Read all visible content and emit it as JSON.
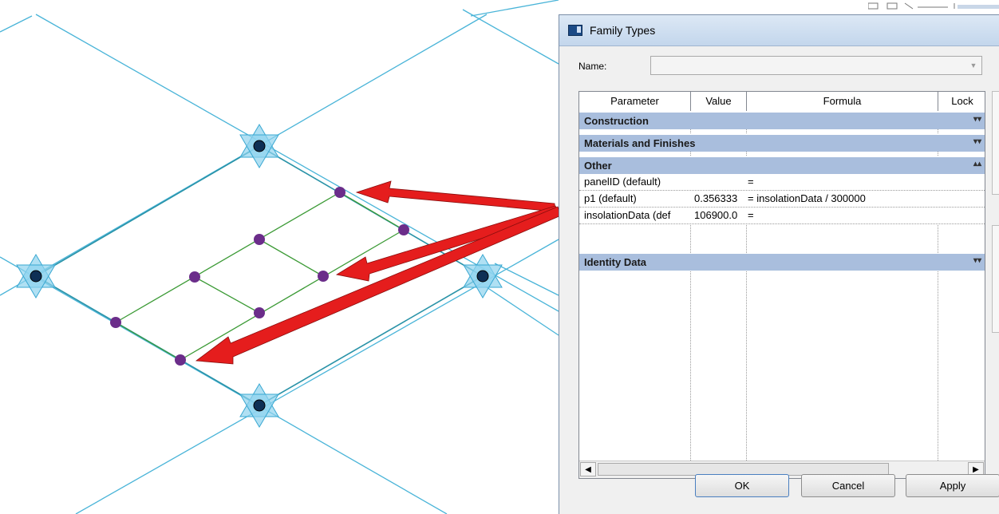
{
  "dialog": {
    "title": "Family Types",
    "name_label": "Name:",
    "name_value": ""
  },
  "table": {
    "headers": [
      "Parameter",
      "Value",
      "Formula",
      "Lock"
    ],
    "groups": [
      {
        "label": "Construction",
        "expanded": false
      },
      {
        "label": "Materials and Finishes",
        "expanded": false
      },
      {
        "label": "Other",
        "expanded": true,
        "rows": [
          {
            "parameter": "panelID (default)",
            "value": "",
            "formula": "="
          },
          {
            "parameter": "p1 (default)",
            "value": "0.356333",
            "formula": "= insolationData / 300000"
          },
          {
            "parameter": "insolationData (def",
            "value": "106900.0",
            "formula": "="
          }
        ]
      },
      {
        "label": "Identity Data",
        "expanded": false
      }
    ]
  },
  "buttons": {
    "ok": "OK",
    "cancel": "Cancel",
    "apply": "Apply"
  },
  "colors": {
    "grid_line": "#49b4d8",
    "panel_edge": "#2a93a8",
    "inner_line": "#3b9a35",
    "node_point": "#6b2d8a",
    "annotation_arrow": "#e51d1d",
    "group_header": "#a9bedd"
  },
  "icons": {
    "app": "family-types-icon",
    "scroll_left": "arrow-left-icon",
    "scroll_right": "arrow-right-icon",
    "dropdown": "chevron-down-icon",
    "collapsed": "double-chevron-down-icon",
    "expanded": "double-chevron-up-icon"
  }
}
